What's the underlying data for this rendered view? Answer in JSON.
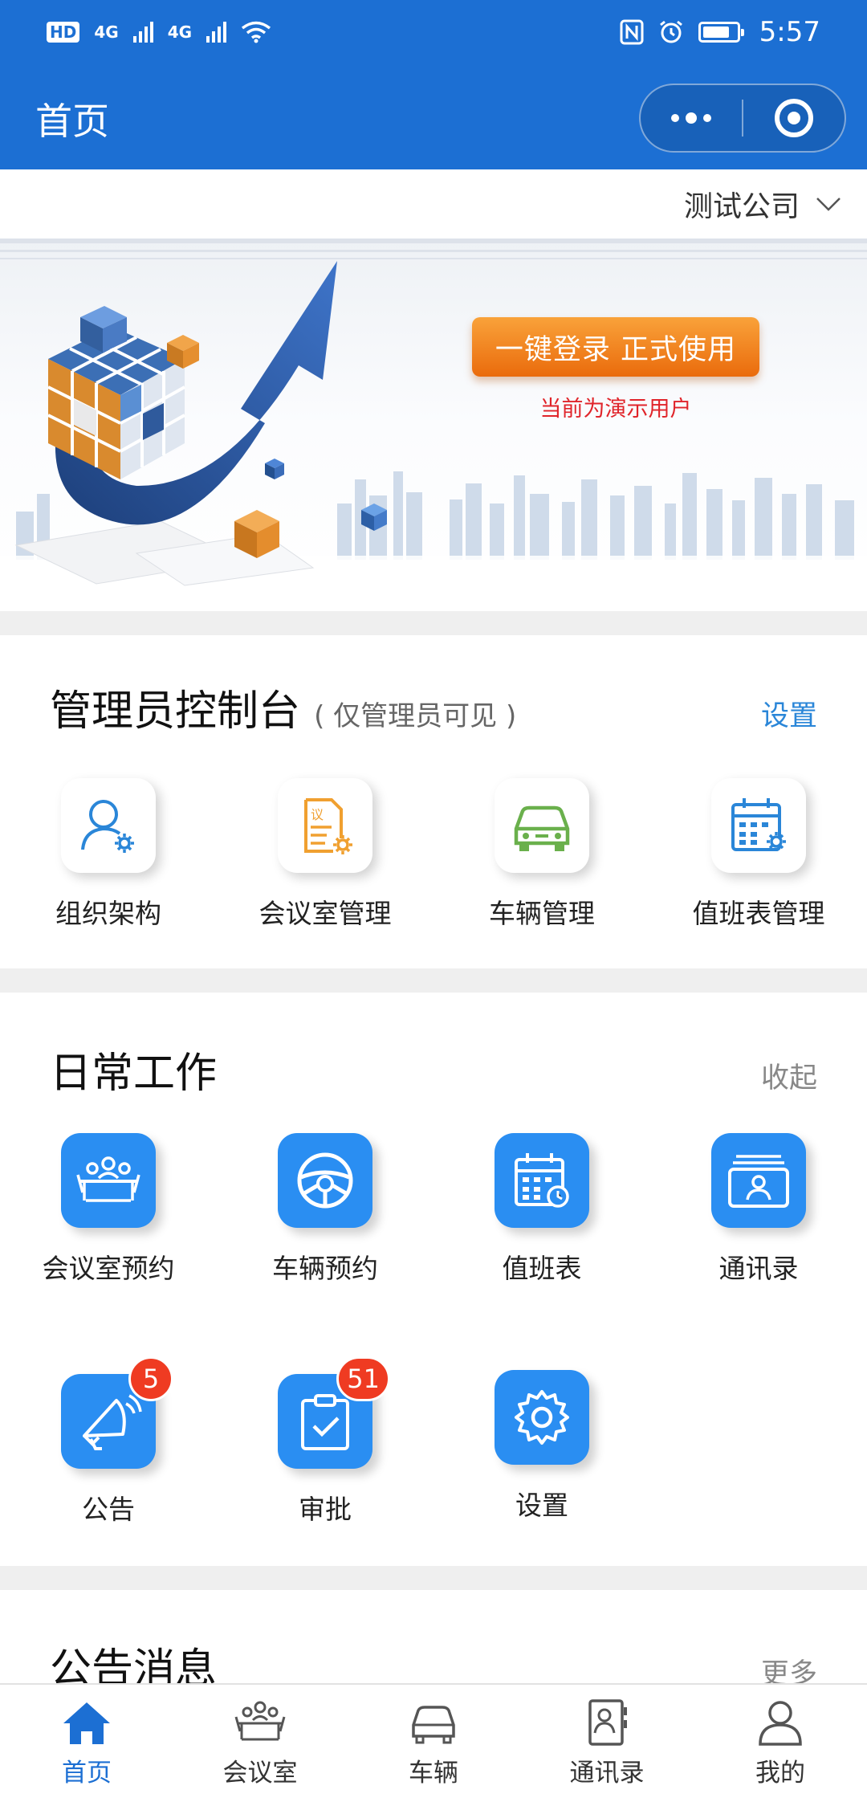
{
  "status_bar": {
    "hd": "HD",
    "sim1_net": "4G",
    "sim2_net": "4G",
    "time": "5:57"
  },
  "header": {
    "title": "首页",
    "more_icon": "more-dots-icon",
    "close_icon": "record-target-icon"
  },
  "company_selector": {
    "label": "测试公司"
  },
  "banner": {
    "login_button": "一键登录 正式使用",
    "demo_note": "当前为演示用户"
  },
  "admin_console": {
    "title": "管理员控制台",
    "subtitle": "( 仅管理员可见 )",
    "action": "设置",
    "items": [
      {
        "label": "组织架构",
        "icon": "user-settings-icon"
      },
      {
        "label": "会议室管理",
        "icon": "document-settings-icon"
      },
      {
        "label": "车辆管理",
        "icon": "car-icon"
      },
      {
        "label": "值班表管理",
        "icon": "calendar-settings-icon"
      }
    ]
  },
  "daily_work": {
    "title": "日常工作",
    "action": "收起",
    "items": [
      {
        "label": "会议室预约",
        "icon": "meeting-room-icon"
      },
      {
        "label": "车辆预约",
        "icon": "steering-wheel-icon"
      },
      {
        "label": "值班表",
        "icon": "calendar-clock-icon"
      },
      {
        "label": "通讯录",
        "icon": "contact-card-icon"
      },
      {
        "label": "公告",
        "icon": "megaphone-icon",
        "badge": "5"
      },
      {
        "label": "审批",
        "icon": "clipboard-check-icon",
        "badge": "51"
      },
      {
        "label": "设置",
        "icon": "gear-icon"
      }
    ]
  },
  "announcements": {
    "title": "公告消息",
    "action": "更多"
  },
  "tabbar": {
    "items": [
      {
        "label": "首页",
        "icon": "home-icon",
        "active": true
      },
      {
        "label": "会议室",
        "icon": "meeting-room-icon"
      },
      {
        "label": "车辆",
        "icon": "car-icon"
      },
      {
        "label": "通讯录",
        "icon": "contacts-book-icon"
      },
      {
        "label": "我的",
        "icon": "person-icon"
      }
    ]
  },
  "colors": {
    "primary": "#1c6fd3",
    "icon_blue": "#2a8ef2",
    "badge_red": "#ef3b22",
    "orange": "#f08a1f",
    "green": "#6ab04c",
    "link_blue": "#2a86d8",
    "muted": "#888888"
  }
}
